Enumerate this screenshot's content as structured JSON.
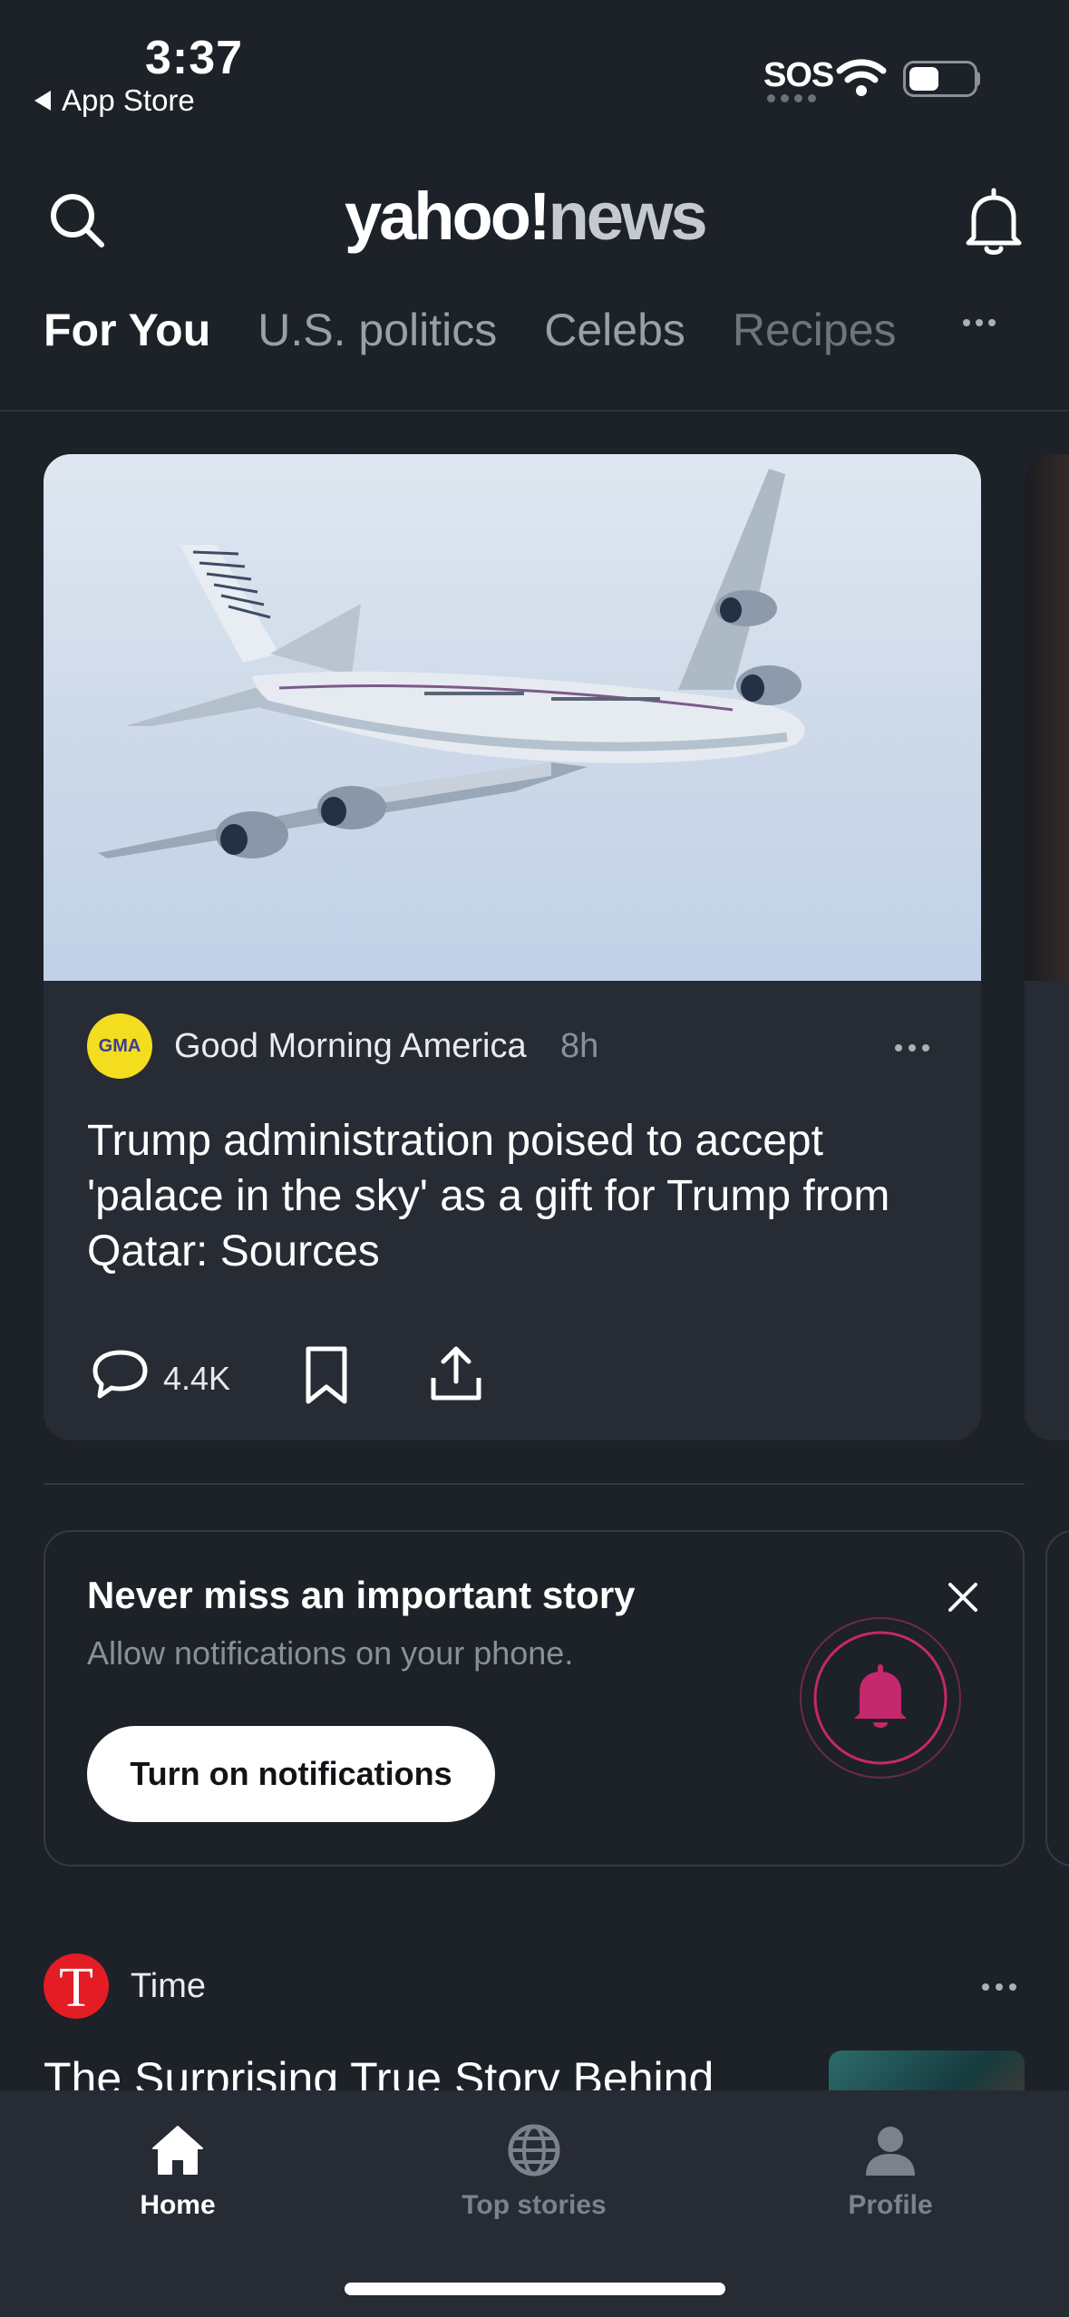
{
  "status_bar": {
    "time": "3:37",
    "back_label": "App Store",
    "sos": "SOS",
    "battery_level": 0.45
  },
  "header": {
    "logo_yahoo": "yahoo!",
    "logo_news": "news",
    "search_icon": "search-icon",
    "bell_icon": "bell-icon"
  },
  "tabs": [
    {
      "label": "For You",
      "active": true
    },
    {
      "label": "U.S. politics",
      "active": false
    },
    {
      "label": "Celebs",
      "active": false
    },
    {
      "label": "Recipes",
      "active": false
    }
  ],
  "hero": {
    "source": "Good Morning America",
    "source_logo_text": "GMA",
    "age": "8h",
    "headline": "Trump administration poised to accept 'palace in the sky' as a gift for Trump from Qatar: Sources",
    "comment_count": "4.4K",
    "image": "airplane-photo"
  },
  "notification_prompt": {
    "title": "Never miss an important story",
    "subtitle": "Allow notifications on your phone.",
    "button": "Turn on notifications",
    "accent": "#c4286d"
  },
  "list_item": {
    "source": "Time",
    "source_logo_text": "T",
    "headline": "The Surprising True Story Behind"
  },
  "bottom_nav": [
    {
      "label": "Home",
      "icon": "home-icon",
      "active": true
    },
    {
      "label": "Top stories",
      "icon": "globe-icon",
      "active": false
    },
    {
      "label": "Profile",
      "icon": "person-icon",
      "active": false
    }
  ]
}
